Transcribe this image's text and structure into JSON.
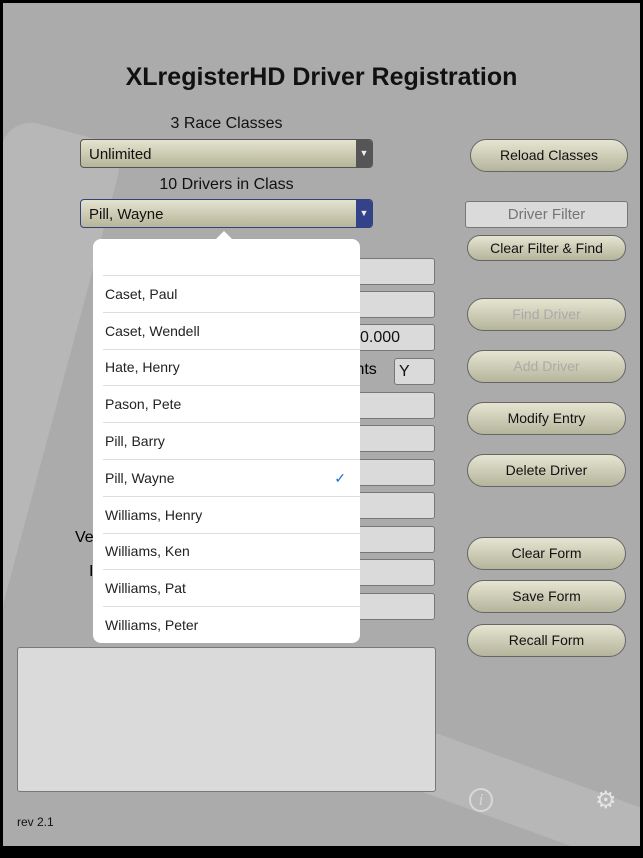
{
  "title": "XLregisterHD Driver Registration",
  "classes": {
    "count_label": "3 Race Classes",
    "selected": "Unlimited"
  },
  "drivers": {
    "count_label": "10 Drivers in Class",
    "selected": "Pill, Wayne"
  },
  "buttons": {
    "reload": "Reload Classes",
    "clear_filter": "Clear Filter & Find",
    "find": "Find Driver",
    "add": "Add Driver",
    "modify": "Modify Entry",
    "delete": "Delete Driver",
    "clear_form": "Clear Form",
    "save_form": "Save Form",
    "recall_form": "Recall Form"
  },
  "filter": {
    "placeholder": "Driver Filter"
  },
  "fields": {
    "value_000": "0.000",
    "points_label": "oints",
    "points_value": "Y",
    "label_ve": "Ve",
    "label_i": "I"
  },
  "dropdown": {
    "items": [
      "",
      "Caset, Paul",
      "Caset, Wendell",
      "Hate, Henry",
      "Pason, Pete",
      "Pill, Barry",
      "Pill, Wayne",
      "Williams, Henry",
      "Williams, Ken",
      "Williams, Pat",
      "Williams, Peter"
    ],
    "checked": "Pill, Wayne",
    "check_color": "#1a6fe0"
  },
  "footer": {
    "rev": "rev 2.1"
  },
  "icons": {
    "info": "info-icon",
    "settings": "gear-icon"
  }
}
